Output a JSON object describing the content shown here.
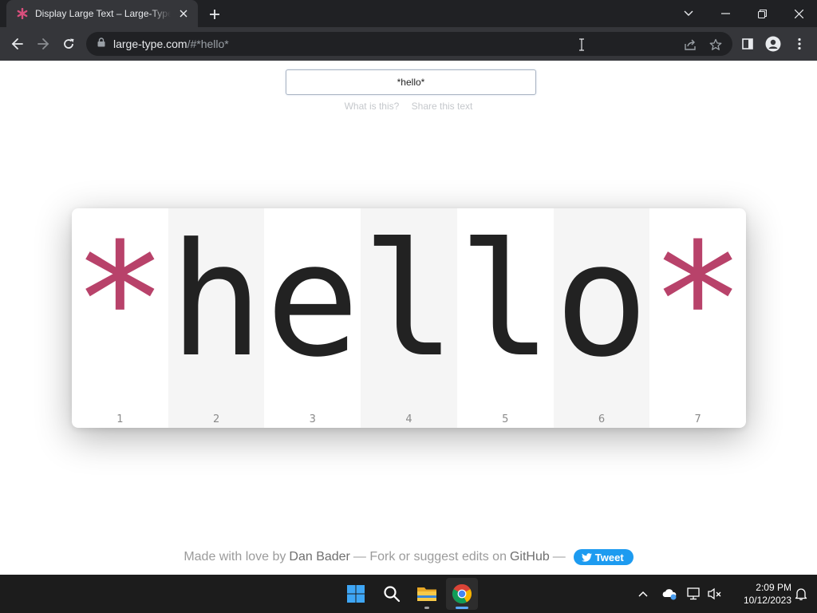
{
  "browser": {
    "tab_title": "Display Large Text – Large-Type.com",
    "url_host": "large-type.com",
    "url_path": "/#*hello*"
  },
  "page": {
    "input_value": "*hello*",
    "links": {
      "what": "What is this?",
      "share": "Share this text"
    },
    "characters": [
      {
        "char": "*",
        "index": "1",
        "symbol": true
      },
      {
        "char": "h",
        "index": "2",
        "symbol": false
      },
      {
        "char": "e",
        "index": "3",
        "symbol": false
      },
      {
        "char": "l",
        "index": "4",
        "symbol": false
      },
      {
        "char": "l",
        "index": "5",
        "symbol": false
      },
      {
        "char": "o",
        "index": "6",
        "symbol": false
      },
      {
        "char": "*",
        "index": "7",
        "symbol": true
      }
    ],
    "footer": {
      "made": "Made with love by",
      "author": "Dan Bader",
      "fork": "— Fork or suggest edits on",
      "github": "GitHub",
      "dash": "—",
      "tweet": "Tweet"
    }
  },
  "taskbar": {
    "time": "2:09 PM",
    "date": "10/12/2023"
  },
  "colors": {
    "symbol": "#b8426a",
    "text": "#222222",
    "tweet": "#1d9bf0"
  }
}
